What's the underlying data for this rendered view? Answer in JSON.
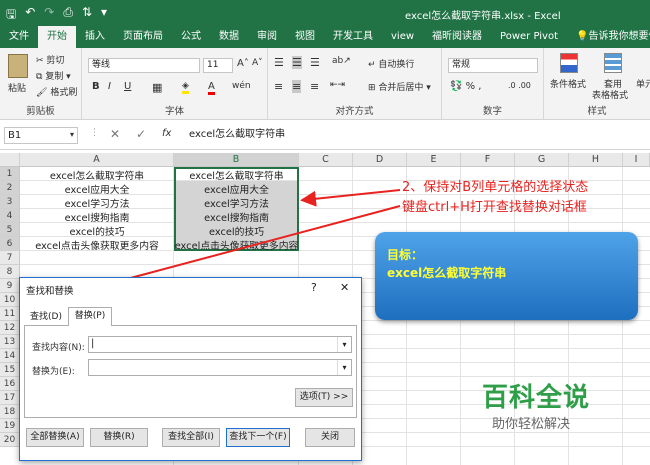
{
  "window": {
    "title": "excel怎么截取字符串.xlsx  -  Excel"
  },
  "tabs": [
    "文件",
    "开始",
    "插入",
    "页面布局",
    "公式",
    "数据",
    "审阅",
    "视图",
    "开发工具",
    "view",
    "福昕阅读器",
    "Power Pivot",
    "告诉我你想要做什么"
  ],
  "ribbon": {
    "clipboard": {
      "paste": "粘贴",
      "cut": "剪切",
      "copy": "复制 ▾",
      "format_painter": "格式刷",
      "label": "剪贴板"
    },
    "font": {
      "name": "等线",
      "size": "11",
      "bold": "B",
      "italic": "I",
      "underline": "U",
      "label": "字体"
    },
    "alignment": {
      "wrap": "自动换行",
      "merge": "合并后居中 ▾",
      "label": "对齐方式"
    },
    "number": {
      "format": "常规",
      "label": "数字"
    },
    "styles": {
      "conditional": "条件格式",
      "table": "套用",
      "table2": "表格格式",
      "cell": "单元",
      "label": "样式"
    }
  },
  "formula_bar": {
    "name_box": "B1",
    "fx": "fx",
    "content": "excel怎么截取字符串"
  },
  "sheet": {
    "columns": [
      "A",
      "B",
      "C",
      "D",
      "E",
      "F",
      "G",
      "H",
      "I"
    ],
    "rows": [
      "1",
      "2",
      "3",
      "4",
      "5",
      "6",
      "7",
      "8",
      "9",
      "10",
      "11",
      "12",
      "13",
      "14",
      "15",
      "16",
      "17",
      "18",
      "19",
      "20"
    ],
    "colA": [
      "excel怎么截取字符串",
      "excel应用大全",
      "excel学习方法",
      "excel搜狗指南",
      "excel的技巧",
      "excel点击头像获取更多内容"
    ],
    "colB": [
      "excel怎么截取字符串",
      "excel应用大全",
      "excel学习方法",
      "excel搜狗指南",
      "excel的技巧",
      "excel点击头像获取更多内容"
    ]
  },
  "annotation": {
    "line1": "2、保持对B列单元格的选择状态",
    "line2": "键盘ctrl+H打开查找替换对话框",
    "color": "#e8231f"
  },
  "goal_bubble": {
    "label": "目标：",
    "text": "excel怎么截取字符串"
  },
  "watermark": {
    "brand": "百科全说",
    "slogan": "助你轻松解决",
    "color": "#2e9e48"
  },
  "dialog": {
    "title": "查找和替换",
    "help": "?",
    "close": "✕",
    "tabs": [
      "查找(D)",
      "替换(P)"
    ],
    "find_label": "查找内容(N):",
    "replace_label": "替换为(E):",
    "options": "选项(T) >>",
    "buttons": [
      "全部替换(A)",
      "替换(R)",
      "查找全部(I)",
      "查找下一个(F)",
      "关闭"
    ]
  }
}
